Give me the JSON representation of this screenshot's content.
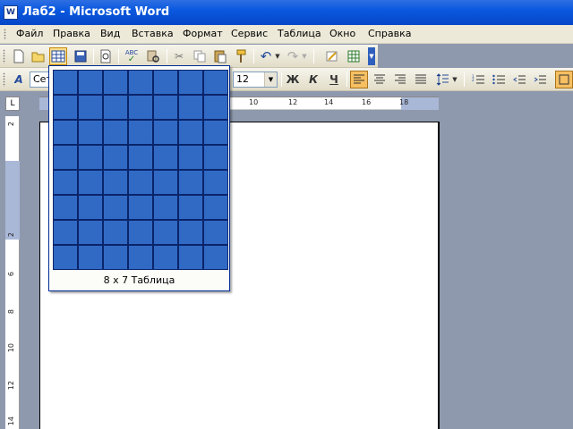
{
  "window": {
    "title": "Лаб2 - Microsoft Word",
    "icon": "word-icon"
  },
  "menu": [
    "Файл",
    "Правка",
    "Вид",
    "Вставка",
    "Формат",
    "Сервис",
    "Таблица",
    "Окно",
    "Справка"
  ],
  "standard_toolbar": {
    "buttons": [
      "new-icon",
      "open-icon",
      "insert-table-icon",
      "save-icon",
      "print-preview-icon",
      "spelling-icon",
      "research-icon",
      "cut-icon",
      "copy-icon",
      "paste-icon",
      "format-painter-icon",
      "undo-icon",
      "redo-icon",
      "insert-hyperlink-icon",
      "insert-excel-icon",
      "toolbar-options-icon"
    ],
    "spelling_label": "ABC"
  },
  "formatting_toolbar": {
    "style_icon_label": "A",
    "font_name": "Сет",
    "font_size": "12",
    "bold": "Ж",
    "italic": "К",
    "underline": "Ч"
  },
  "ruler": {
    "tab_selector": "L",
    "h_numbers": [
      "10",
      "12",
      "14",
      "16",
      "18"
    ],
    "v_numbers": [
      "2",
      "2",
      "4",
      "6",
      "8",
      "10",
      "12",
      "14"
    ]
  },
  "table_picker": {
    "rows": 8,
    "columns": 7,
    "label": "8 x 7 Таблица"
  }
}
